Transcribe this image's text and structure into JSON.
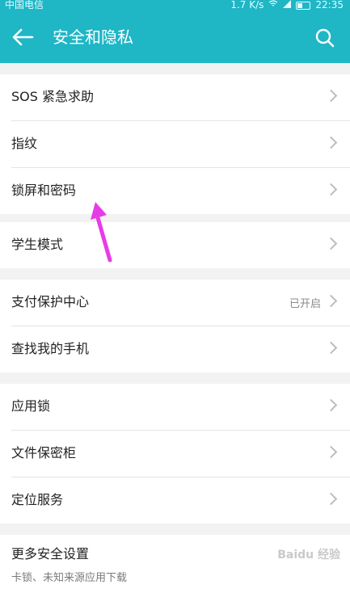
{
  "status_bar": {
    "carrier": "中国电信",
    "speed": "1.7 K/s",
    "time": "22:35"
  },
  "header": {
    "title": "安全和隐私"
  },
  "groups": [
    {
      "items": [
        {
          "label": "SOS 紧急求助"
        },
        {
          "label": "指纹"
        },
        {
          "label": "锁屏和密码"
        }
      ]
    },
    {
      "items": [
        {
          "label": "学生模式"
        }
      ]
    },
    {
      "items": [
        {
          "label": "支付保护中心",
          "value": "已开启"
        },
        {
          "label": "查找我的手机"
        }
      ]
    },
    {
      "items": [
        {
          "label": "应用锁"
        },
        {
          "label": "文件保密柜"
        },
        {
          "label": "定位服务"
        }
      ]
    },
    {
      "items": [
        {
          "label": "更多安全设置",
          "sublabel": "卡锁、未知来源应用下载"
        }
      ]
    }
  ],
  "watermark": "Baidu 经验",
  "colors": {
    "accent": "#1fb6c6",
    "annotation_arrow": "#e83be8"
  }
}
